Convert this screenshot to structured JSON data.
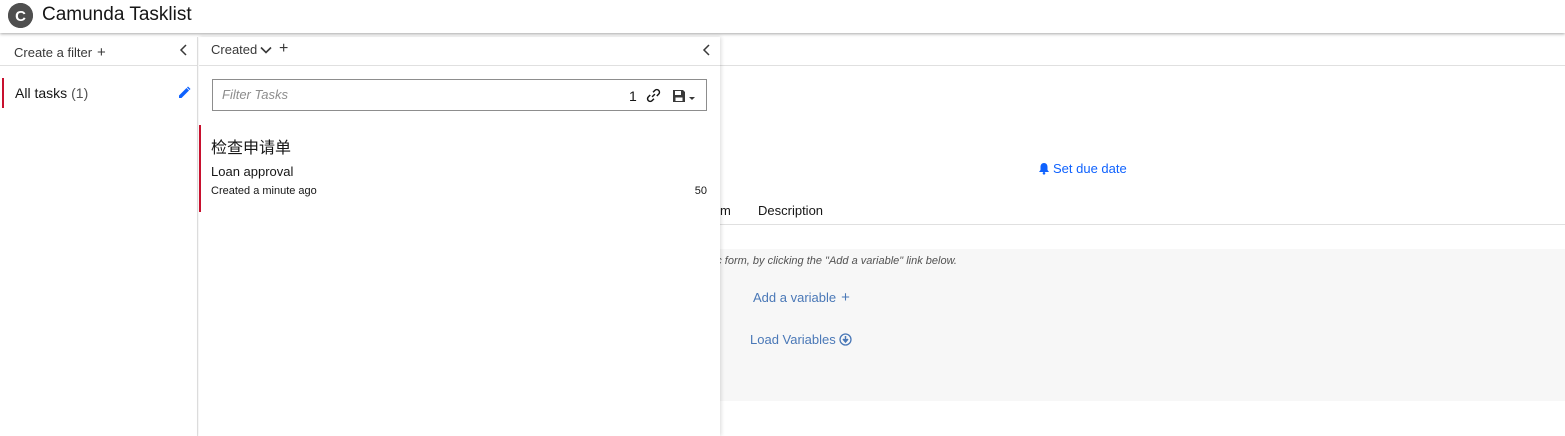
{
  "header": {
    "title": "Camunda Tasklist",
    "logo_letter": "C"
  },
  "filters": {
    "create_label": "Create a filter",
    "items": [
      {
        "label": "All tasks",
        "count": "(1)"
      }
    ]
  },
  "tasklist": {
    "sort_label": "Created",
    "search": {
      "placeholder": "Filter Tasks",
      "count": "1"
    },
    "tasks": [
      {
        "name": "检查申请单",
        "process": "Loan approval",
        "created": "Created a minute ago",
        "priority": "50"
      }
    ]
  },
  "detail": {
    "due_date_label": "Set due date",
    "tabs": [
      "m",
      "Description"
    ],
    "form_hint": "eric form, by clicking the \"Add a variable\" link below.",
    "add_variable": "Add a variable",
    "load_variables": "Load Variables"
  },
  "colors": {
    "accent_red": "#c8102e",
    "link_blue": "#0f62fe",
    "muted_blue": "#4a78b7"
  }
}
